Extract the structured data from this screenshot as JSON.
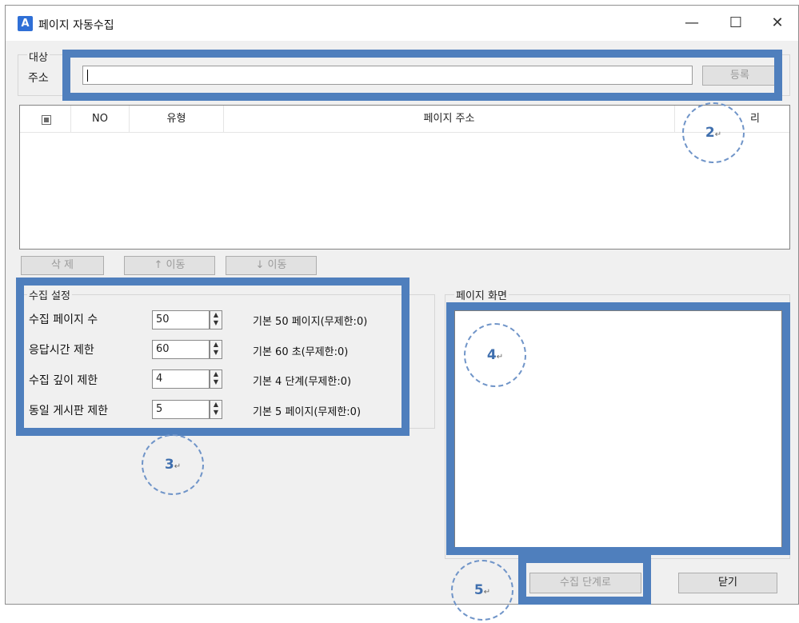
{
  "window": {
    "title": "페이지 자동수집",
    "icon_letter": "A",
    "controls": {
      "minimize": "—",
      "maximize": "☐",
      "close": "✕"
    }
  },
  "target_group": {
    "legend": "대상",
    "address_label": "주소",
    "address_value": "",
    "register_button": "등록"
  },
  "page_list": {
    "columns": [
      "",
      "NO",
      "유형",
      "페이지 주소",
      "리"
    ],
    "rows": []
  },
  "list_actions": {
    "delete": "삭 제",
    "move_up": "↑  이동",
    "move_down": "↓  이동"
  },
  "collect_settings": {
    "legend": "수집 설정",
    "items": [
      {
        "label": "수집 페이지 수",
        "value": "50",
        "hint": "기본 50 페이지(무제한:0)"
      },
      {
        "label": "응답시간 제한",
        "value": "60",
        "hint": "기본 60 초(무제한:0)"
      },
      {
        "label": "수집 깊이 제한",
        "value": "4",
        "hint": "기본 4 단계(무제한:0)"
      },
      {
        "label": "동일 게시판 제한",
        "value": "5",
        "hint": "기본 5 페이지(무제한:0)"
      }
    ]
  },
  "page_view": {
    "legend": "페이지 화면"
  },
  "footer": {
    "collect_step_button": "수집 단계로",
    "close_button": "닫기"
  },
  "callouts": [
    "2",
    "3",
    "4",
    "5"
  ],
  "return_mark": "↵",
  "colors": {
    "highlight_border": "#4f7fbd",
    "callout_dash": "#6f94c8",
    "window_bg": "#f0f0f0",
    "app_icon": "#2f6fd6"
  }
}
